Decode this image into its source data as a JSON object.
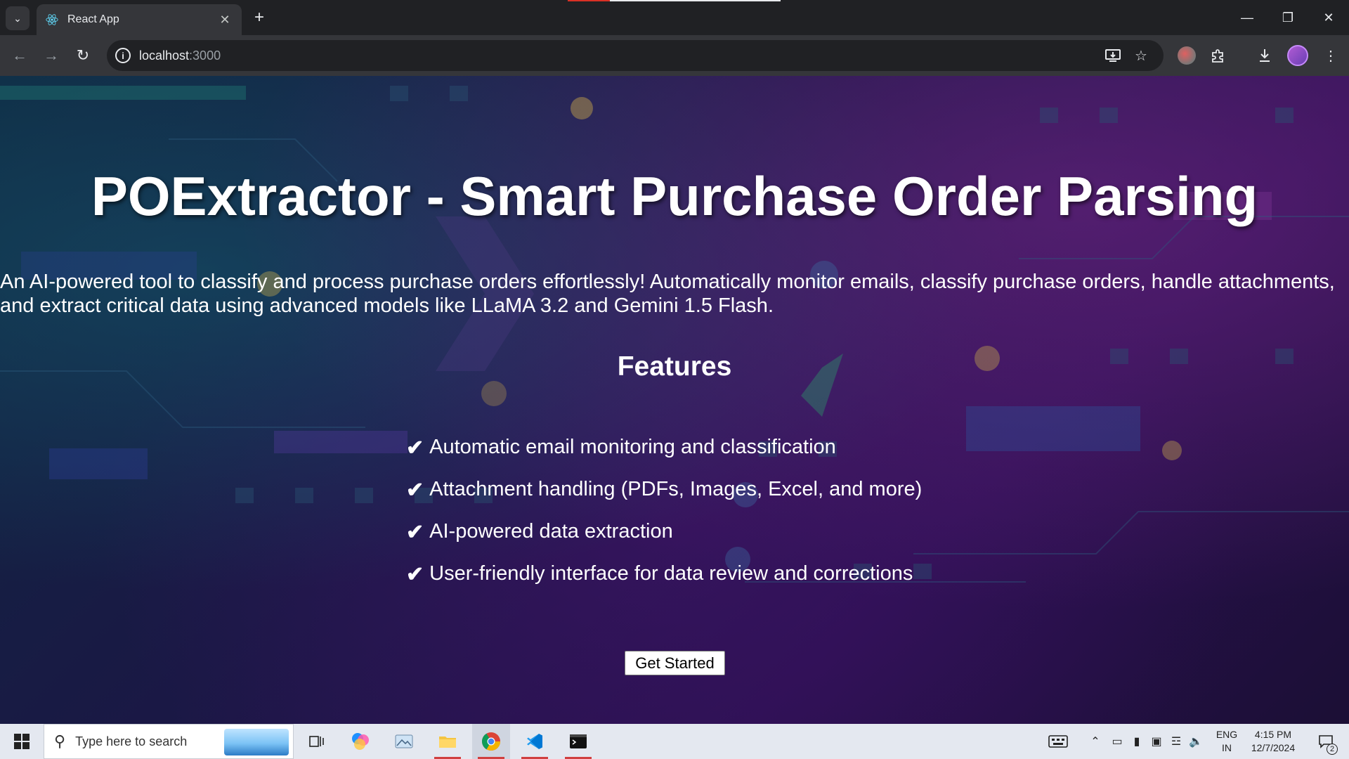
{
  "browser": {
    "tab_title": "React App",
    "url_host": "localhost",
    "url_port": ":3000"
  },
  "page": {
    "title": "POExtractor - Smart Purchase Order Parsing",
    "description": "An AI-powered tool to classify and process purchase orders effortlessly! Automatically monitor emails, classify purchase orders, handle attachments, and extract critical data using advanced models like LLaMA 3.2 and Gemini 1.5 Flash.",
    "features_heading": "Features",
    "check_glyph": "✔",
    "features": [
      "Automatic email monitoring and classification",
      "Attachment handling (PDFs, Images, Excel, and more)",
      "AI-powered data extraction",
      "User-friendly interface for data review and corrections"
    ],
    "cta_label": "Get Started"
  },
  "taskbar": {
    "search_placeholder": "Type here to search",
    "lang_line1": "ENG",
    "lang_line2": "IN",
    "time": "4:15 PM",
    "date": "12/7/2024",
    "notification_count": "2"
  },
  "colors": {
    "chrome_bg": "#202124",
    "toolbar_bg": "#35363a",
    "page_text": "#ffffff",
    "taskbar_bg": "#e4e8f0"
  }
}
